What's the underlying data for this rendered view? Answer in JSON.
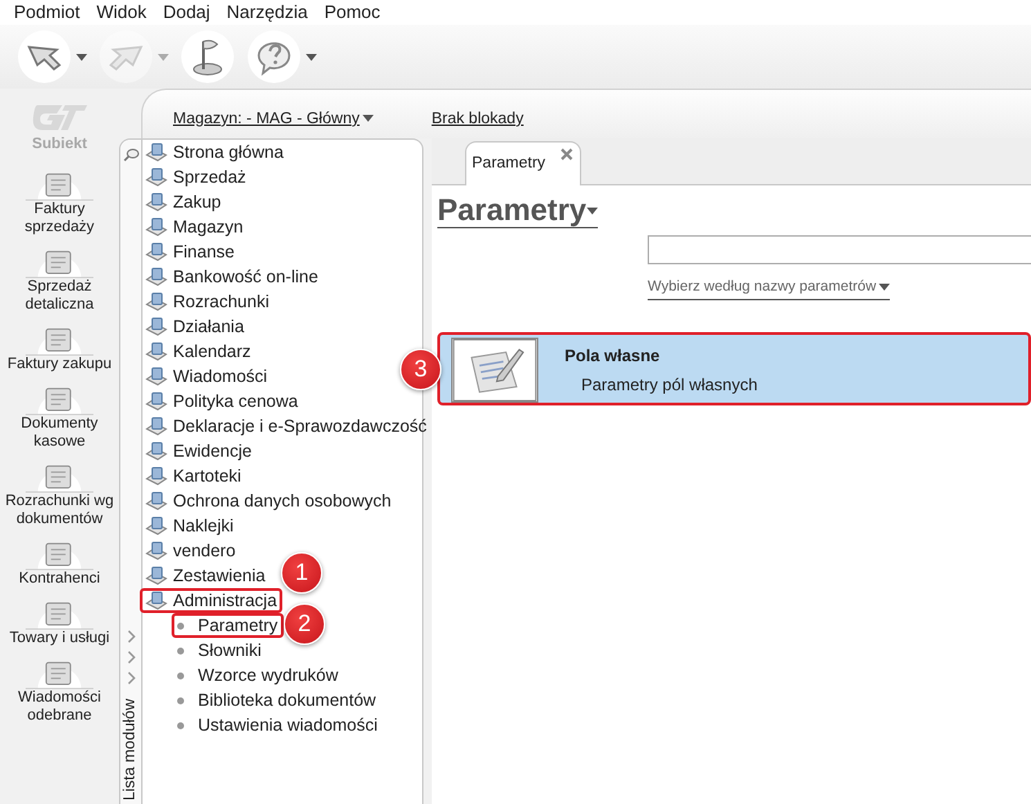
{
  "menu": [
    "Podmiot",
    "Widok",
    "Dodaj",
    "Narzędzia",
    "Pomoc"
  ],
  "toolbar": [
    {
      "dropdown": true,
      "disabled": false
    },
    {
      "dropdown": true,
      "disabled": true
    },
    {
      "dropdown": false,
      "disabled": false
    },
    {
      "dropdown": true,
      "disabled": false
    }
  ],
  "sidebar": {
    "logo": "Subiekt",
    "items": [
      {
        "label": "Faktury sprzedaży"
      },
      {
        "label": "Sprzedaż detaliczna"
      },
      {
        "label": "Faktury zakupu"
      },
      {
        "label": "Dokumenty kasowe"
      },
      {
        "label": "Rozrachunki wg dokumentów"
      },
      {
        "label": "Kontrahenci"
      },
      {
        "label": "Towary i usługi"
      },
      {
        "label": "Wiadomości odebrane"
      }
    ]
  },
  "header": {
    "warehouse": "Magazyn: - MAG - Główny",
    "lock": "Brak blokady"
  },
  "modules": {
    "panel_label": "Lista modułów",
    "items": [
      {
        "label": "Strona główna",
        "highlighted": false
      },
      {
        "label": "Sprzedaż",
        "highlighted": false
      },
      {
        "label": "Zakup",
        "highlighted": false
      },
      {
        "label": "Magazyn",
        "highlighted": false
      },
      {
        "label": "Finanse",
        "highlighted": false
      },
      {
        "label": "Bankowość on-line",
        "highlighted": false
      },
      {
        "label": "Rozrachunki",
        "highlighted": false
      },
      {
        "label": "Działania",
        "highlighted": false
      },
      {
        "label": "Kalendarz",
        "highlighted": false
      },
      {
        "label": "Wiadomości",
        "highlighted": false
      },
      {
        "label": "Polityka cenowa",
        "highlighted": false
      },
      {
        "label": "Deklaracje i e-Sprawozdawczość",
        "highlighted": false
      },
      {
        "label": "Ewidencje",
        "highlighted": false
      },
      {
        "label": "Kartoteki",
        "highlighted": false
      },
      {
        "label": "Ochrona danych osobowych",
        "highlighted": false
      },
      {
        "label": "Naklejki",
        "highlighted": false
      },
      {
        "label": "vendero",
        "highlighted": false
      },
      {
        "label": "Zestawienia",
        "highlighted": false
      },
      {
        "label": "Administracja",
        "highlighted": true,
        "annotation": "1",
        "children": [
          {
            "label": "Parametry",
            "highlighted": true,
            "annotation": "2"
          },
          {
            "label": "Słowniki",
            "highlighted": false
          },
          {
            "label": "Wzorce wydruków",
            "highlighted": false
          },
          {
            "label": "Biblioteka dokumentów",
            "highlighted": false
          },
          {
            "label": "Ustawienia wiadomości",
            "highlighted": false
          }
        ]
      }
    ]
  },
  "tabs": [
    {
      "label": "Parametry",
      "selected": true
    }
  ],
  "page": {
    "title": "Parametry",
    "filter": "Wybierz według nazwy parametrów"
  },
  "results": [
    {
      "title": "Pola własne",
      "subtitle": "Parametry pól własnych",
      "selected": true,
      "highlighted": true,
      "annotation": "3"
    }
  ]
}
